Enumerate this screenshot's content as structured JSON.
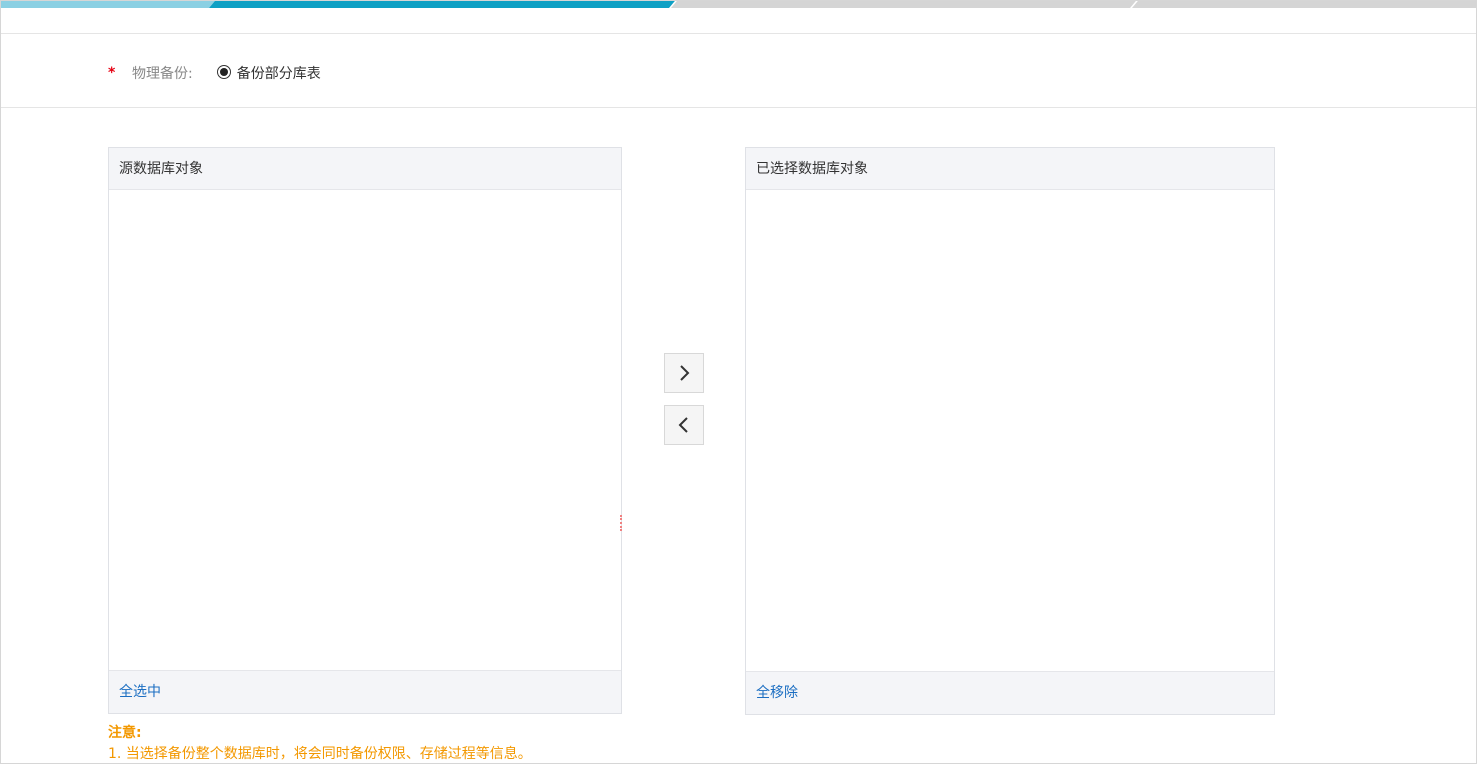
{
  "form": {
    "required_mark": "*",
    "label": "物理备份:",
    "option_label": "备份部分库表"
  },
  "source_panel": {
    "title": "源数据库对象",
    "footer_link": "全选中"
  },
  "target_panel": {
    "title": "已选择数据库对象",
    "footer_link": "全移除"
  },
  "notice": {
    "title": "注意:",
    "line1": "1. 当选择备份整个数据库时，将会同时备份权限、存储过程等信息。"
  },
  "colors": {
    "step_done": "#8bd0e3",
    "step_active": "#0fa0c4",
    "step_pending": "#d5d5d5",
    "link": "#1b6ec2",
    "notice": "#f39800",
    "required": "#e60012"
  },
  "icons": {
    "move_right": "chevron-right-icon",
    "move_left": "chevron-left-icon"
  }
}
